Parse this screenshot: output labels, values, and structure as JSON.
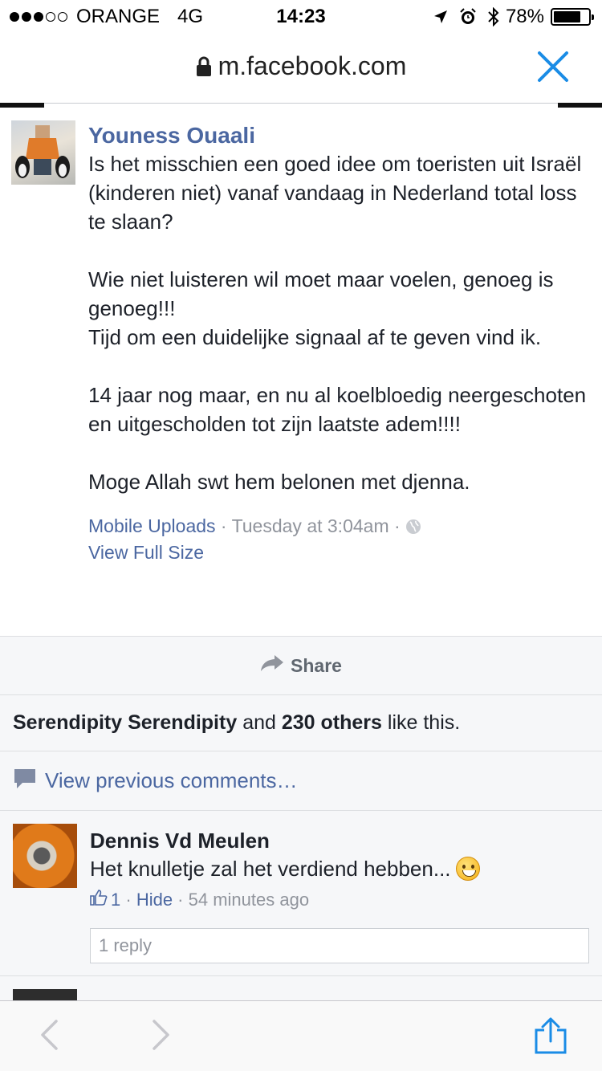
{
  "status_bar": {
    "carrier": "ORANGE",
    "network": "4G",
    "time": "14:23",
    "battery": "78%",
    "battery_level": 0.78
  },
  "url_bar": {
    "domain": "m.facebook.com"
  },
  "post": {
    "author": "Youness Ouaali",
    "paragraphs": [
      "Is het misschien een goed idee om toeristen uit Israël (kinderen niet) vanaf vandaag in Nederland total loss te slaan?",
      "Wie niet luisteren wil moet maar voelen, genoeg is genoeg!!!\nTijd om een duidelijke signaal af te geven vind ik.",
      "14 jaar nog maar, en nu al koelbloedig neergeschoten en uitgescholden tot zijn laatste adem!!!!",
      "Moge Allah swt hem belonen met djenna."
    ],
    "album": "Mobile Uploads",
    "time": "Tuesday at 3:04am",
    "view_full_size": "View Full Size"
  },
  "share": {
    "label": "Share"
  },
  "likes": {
    "first_name": "Serendipity Serendipity",
    "and": "and",
    "others": "230 others",
    "suffix": "like this."
  },
  "view_previous": "View previous comments…",
  "comments": [
    {
      "name": "Dennis Vd Meulen",
      "text": "Het knulletje zal het verdiend hebben...",
      "likes": "1",
      "hide": "Hide",
      "time": "54 minutes ago",
      "replies": "1 reply"
    }
  ],
  "colors": {
    "link_blue": "#4b67a1",
    "safari_blue": "#1a8ce6",
    "feed_bg": "#f6f7f9"
  }
}
